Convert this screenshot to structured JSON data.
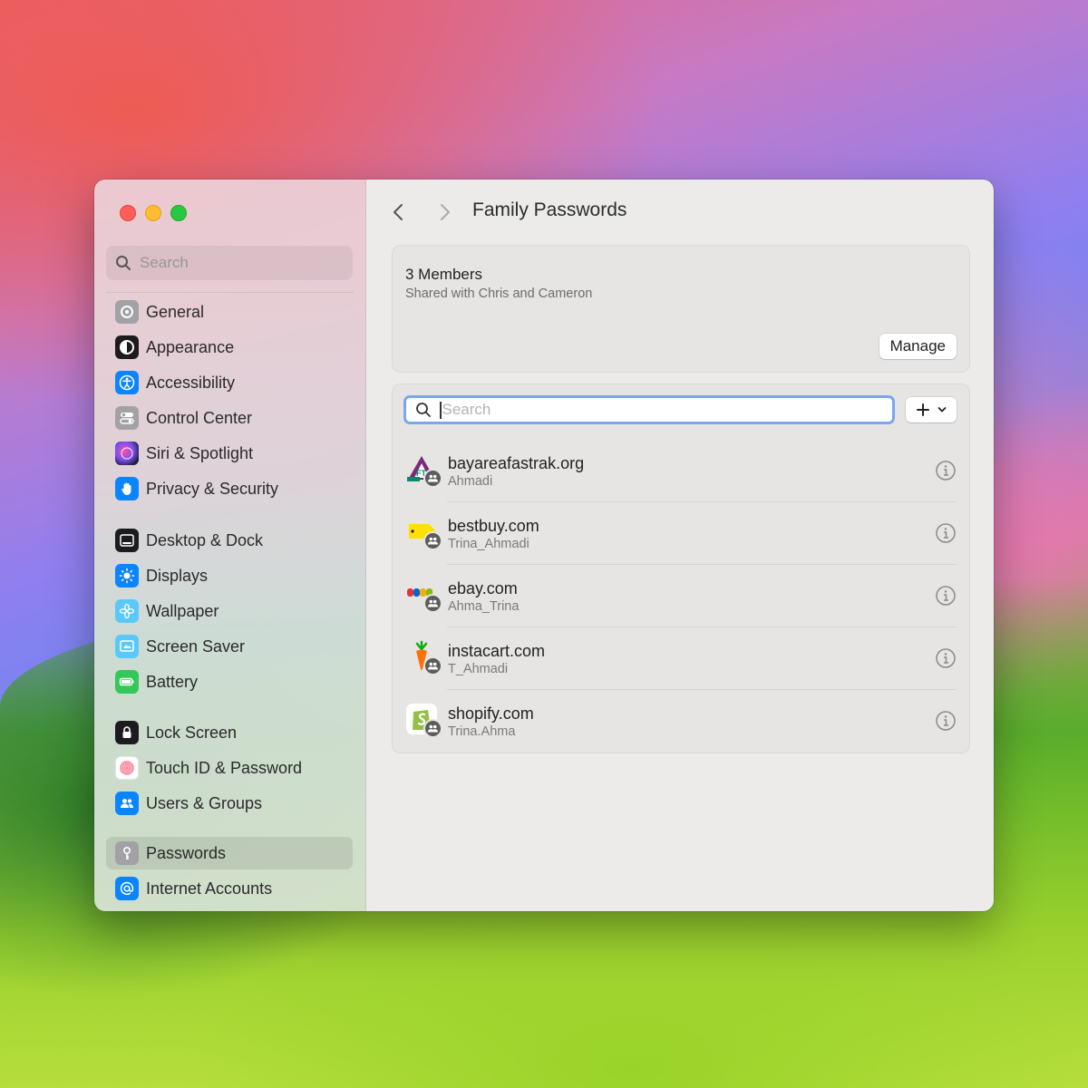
{
  "sidebar": {
    "search_placeholder": "Search",
    "items": [
      {
        "label": "General",
        "icon": "gear-icon",
        "color": "#8e8e93"
      },
      {
        "label": "Appearance",
        "icon": "appearance-icon",
        "color": "#1c1c1e"
      },
      {
        "label": "Accessibility",
        "icon": "accessibility-icon",
        "color": "#0a84ff"
      },
      {
        "label": "Control Center",
        "icon": "control-center-icon",
        "color": "#8e8e93"
      },
      {
        "label": "Siri & Spotlight",
        "icon": "siri-icon",
        "color": "#5e5ce6"
      },
      {
        "label": "Privacy & Security",
        "icon": "hand-icon",
        "color": "#0a84ff"
      },
      {
        "label": "Desktop & Dock",
        "icon": "dock-icon",
        "color": "#1c1c1e"
      },
      {
        "label": "Displays",
        "icon": "sun-icon",
        "color": "#0a84ff"
      },
      {
        "label": "Wallpaper",
        "icon": "flower-icon",
        "color": "#5ac8fa"
      },
      {
        "label": "Screen Saver",
        "icon": "screen-saver-icon",
        "color": "#5ac8fa"
      },
      {
        "label": "Battery",
        "icon": "battery-icon",
        "color": "#34c759"
      },
      {
        "label": "Lock Screen",
        "icon": "lock-icon",
        "color": "#1c1c1e"
      },
      {
        "label": "Touch ID & Password",
        "icon": "fingerprint-icon",
        "color": "#ff6482"
      },
      {
        "label": "Users & Groups",
        "icon": "users-icon",
        "color": "#0a84ff"
      },
      {
        "label": "Passwords",
        "icon": "key-icon",
        "color": "#8e8e93",
        "selected": true
      },
      {
        "label": "Internet Accounts",
        "icon": "at-icon",
        "color": "#0a84ff"
      }
    ]
  },
  "header": {
    "title": "Family Passwords"
  },
  "members": {
    "title": "3 Members",
    "subtitle": "Shared with Chris and Cameron",
    "manage_label": "Manage"
  },
  "list": {
    "search_placeholder": "Search",
    "items": [
      {
        "site": "bayareafastrak.org",
        "user": "Ahmadi",
        "icon": "fastrak-logo"
      },
      {
        "site": "bestbuy.com",
        "user": "Trina_Ahmadi",
        "icon": "bestbuy-logo"
      },
      {
        "site": "ebay.com",
        "user": "Ahma_Trina",
        "icon": "ebay-logo"
      },
      {
        "site": "instacart.com",
        "user": "T_Ahmadi",
        "icon": "instacart-logo"
      },
      {
        "site": "shopify.com",
        "user": "Trina.Ahma",
        "icon": "shopify-logo"
      }
    ]
  },
  "colors": {
    "accent": "#7aa6f0",
    "selection": "#0a84ff"
  }
}
